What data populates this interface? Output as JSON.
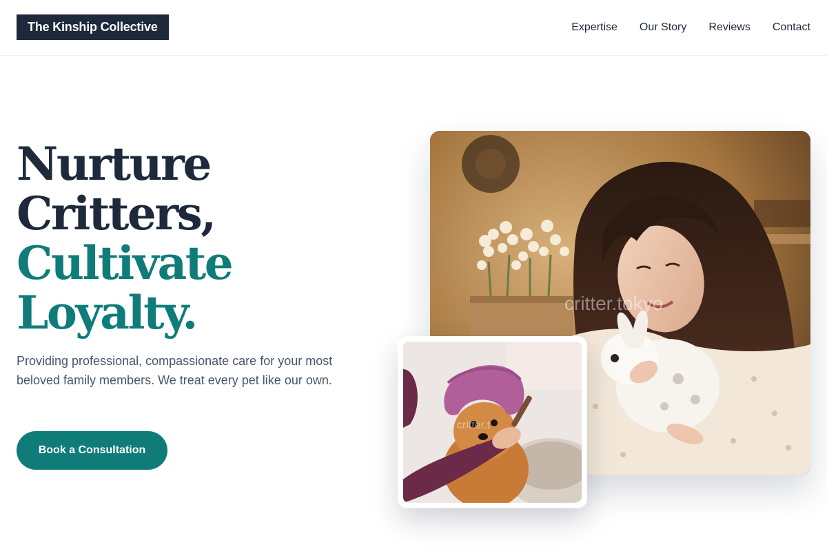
{
  "header": {
    "logo_text": "The Kinship Collective",
    "nav": [
      {
        "label": "Expertise"
      },
      {
        "label": "Our Story"
      },
      {
        "label": "Reviews"
      },
      {
        "label": "Contact"
      }
    ]
  },
  "hero": {
    "title_line1": "Nurture",
    "title_line2": "Critters,",
    "title_line3": "Cultivate",
    "title_line4": "Loyalty.",
    "description": "Providing professional, compassionate care for your most beloved family members. We treat every pet like our own.",
    "cta_label": "Book a Consultation"
  },
  "images": {
    "main_watermark": "critter.tokyo",
    "inset_watermark": "critter.t"
  },
  "colors": {
    "brand_dark": "#1e293b",
    "accent_teal": "#0f7c7a",
    "body_text": "#475569",
    "background": "#ffffff"
  }
}
